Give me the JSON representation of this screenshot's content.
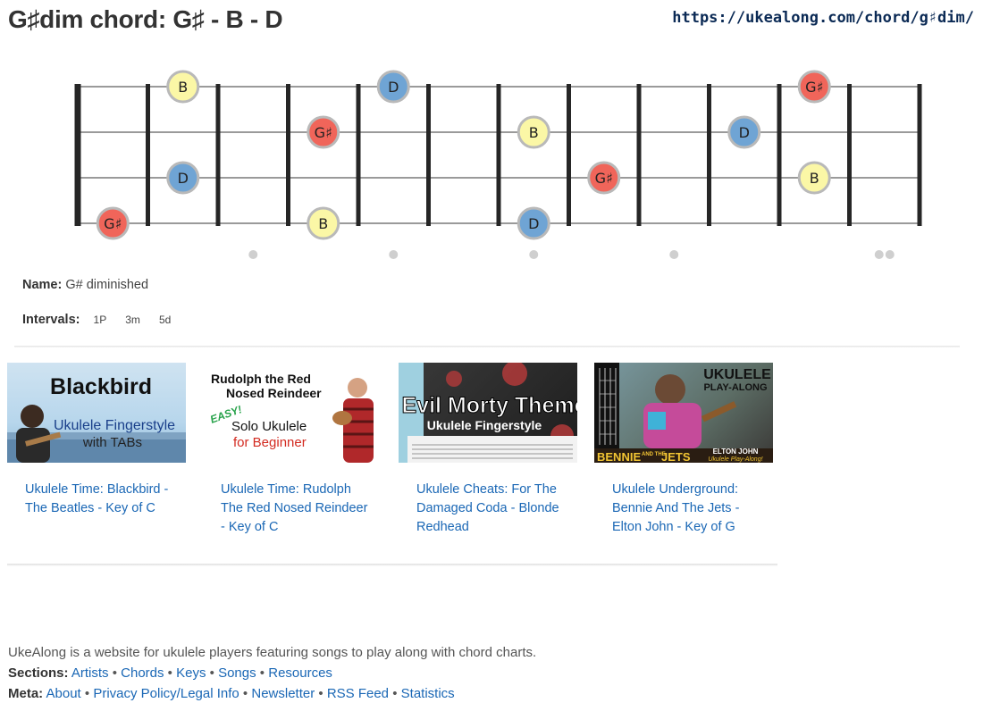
{
  "title": "G♯dim chord: G♯ - B - D",
  "url": "https://ukealong.com/chord/g♯dim/",
  "chord": {
    "strings": 4,
    "frets": 12,
    "notes": [
      {
        "string": 1,
        "fret": 2,
        "label": "B",
        "type": "B"
      },
      {
        "string": 1,
        "fret": 5,
        "label": "D",
        "type": "D"
      },
      {
        "string": 1,
        "fret": 11,
        "label": "G♯",
        "type": "G"
      },
      {
        "string": 2,
        "fret": 4,
        "label": "G♯",
        "type": "G"
      },
      {
        "string": 2,
        "fret": 7,
        "label": "B",
        "type": "B"
      },
      {
        "string": 2,
        "fret": 10,
        "label": "D",
        "type": "D"
      },
      {
        "string": 3,
        "fret": 2,
        "label": "D",
        "type": "D"
      },
      {
        "string": 3,
        "fret": 8,
        "label": "G♯",
        "type": "G"
      },
      {
        "string": 3,
        "fret": 11,
        "label": "B",
        "type": "B"
      },
      {
        "string": 4,
        "fret": 1,
        "label": "G♯",
        "type": "G"
      },
      {
        "string": 4,
        "fret": 4,
        "label": "B",
        "type": "B"
      },
      {
        "string": 4,
        "fret": 7,
        "label": "D",
        "type": "D"
      }
    ],
    "inlays": [
      {
        "fret": 3,
        "count": 1
      },
      {
        "fret": 5,
        "count": 1
      },
      {
        "fret": 7,
        "count": 1
      },
      {
        "fret": 9,
        "count": 1
      },
      {
        "fret": 12,
        "count": 2
      }
    ],
    "colors": {
      "G": "#f0655a",
      "B": "#fbf7a6",
      "D": "#6fa4d4"
    }
  },
  "info": {
    "name_label": "Name:",
    "name_value": "G# diminished",
    "intervals_label": "Intervals:",
    "intervals": [
      "1P",
      "3m",
      "5d"
    ]
  },
  "videos": [
    {
      "title": "Ukulele Time: Blackbird - The Beatles - Key of C",
      "thumb_text": [
        "Blackbird",
        "Ukulele Fingerstyle",
        "with TABs"
      ]
    },
    {
      "title": "Ukulele Time: Rudolph The Red Nosed Reindeer - Key of C",
      "thumb_text": [
        "Rudolph the Red",
        "Nosed Reindeer",
        "EASY!",
        "Solo Ukulele",
        "for Beginner"
      ]
    },
    {
      "title": "Ukulele Cheats: For The Damaged Coda - Blonde Redhead",
      "thumb_text": [
        "Evil Morty Theme",
        "Ukulele Fingerstyle"
      ]
    },
    {
      "title": "Ukulele Underground: Bennie And The Jets - Elton John - Key of G",
      "thumb_text": [
        "UKULELE",
        "PLAY-ALONG",
        "BENNIE",
        "AND THE",
        "JETS",
        "ELTON JOHN",
        "Ukulele Play-Along!"
      ]
    }
  ],
  "footer": {
    "description": "UkeAlong is a website for ukulele players featuring songs to play along with chord charts.",
    "sections_label": "Sections:",
    "sections": [
      "Artists",
      "Chords",
      "Keys",
      "Songs",
      "Resources"
    ],
    "meta_label": "Meta:",
    "meta": [
      "About",
      "Privacy Policy/Legal Info",
      "Newsletter",
      "RSS Feed",
      "Statistics"
    ]
  }
}
